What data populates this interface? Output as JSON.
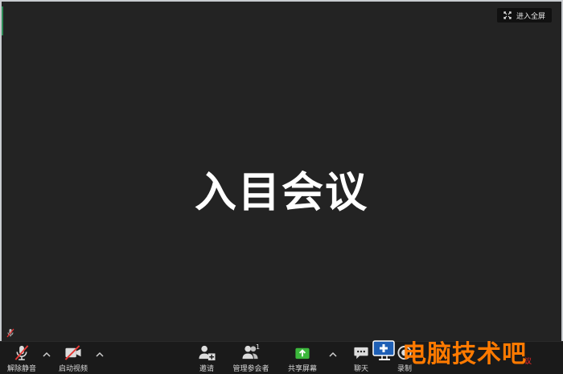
{
  "window": {
    "fullscreen_button": {
      "label": "进入全屏",
      "icon": "fullscreen-icon"
    },
    "meeting_title": "入目会议"
  },
  "toolbar": {
    "unmute": {
      "label": "解除静音",
      "icon": "microphone-muted-icon"
    },
    "start_video": {
      "label": "启动视频",
      "icon": "video-camera-off-icon"
    },
    "invite": {
      "label": "邀请",
      "icon": "add-user-icon"
    },
    "participants": {
      "label": "管理参会者",
      "icon": "participants-icon",
      "count": "1"
    },
    "share_screen": {
      "label": "共享屏幕",
      "icon": "share-screen-icon",
      "color": "#3cb83c"
    },
    "chat": {
      "label": "聊天",
      "icon": "chat-bubble-icon"
    },
    "record": {
      "label": "录制",
      "icon": "record-icon"
    }
  },
  "watermark": {
    "text": "电脑技术吧",
    "small_text": "议",
    "color": "#ff7a00"
  }
}
